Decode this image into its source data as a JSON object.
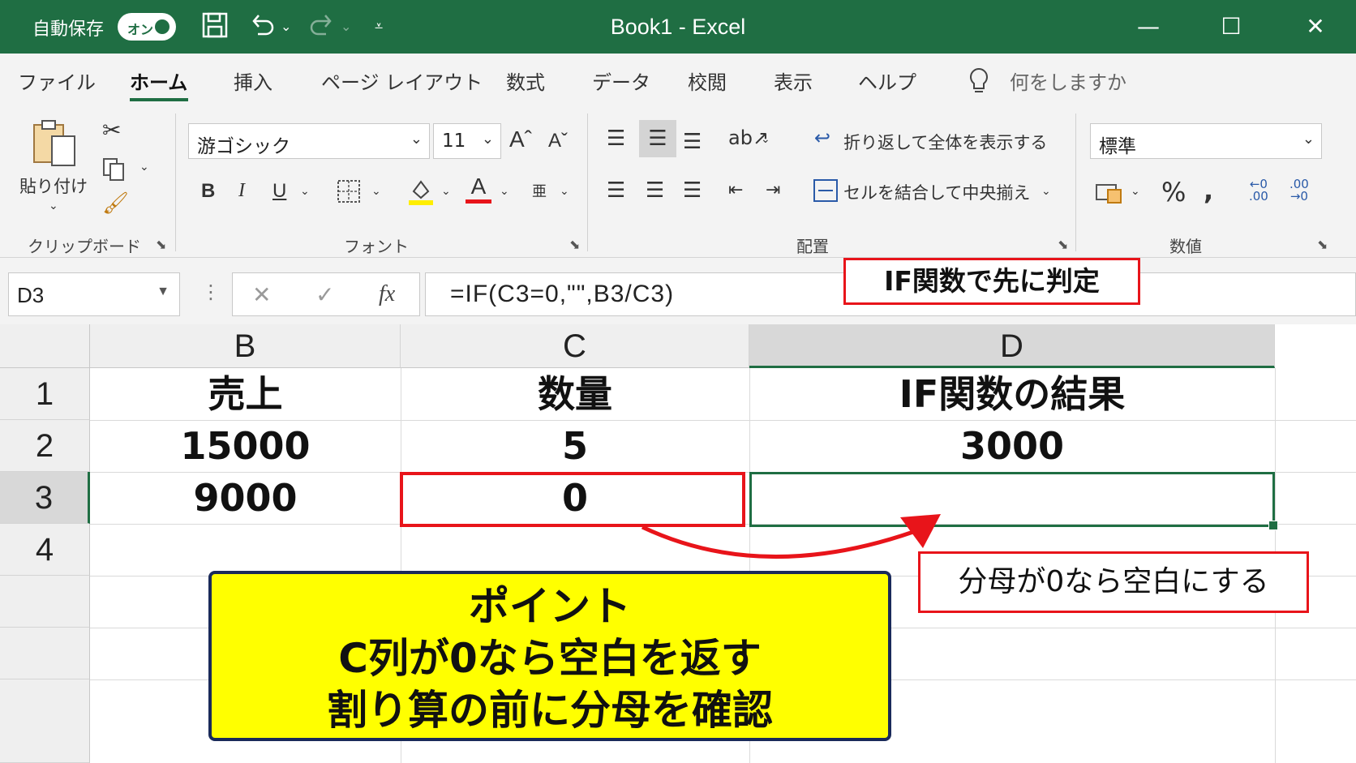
{
  "titlebar": {
    "autosave_label": "自動保存",
    "autosave_state": "オン",
    "title": "Book1  -  Excel"
  },
  "tabs": [
    "ファイル",
    "ホーム",
    "挿入",
    "ページ レイアウト",
    "数式",
    "データ",
    "校閲",
    "表示",
    "ヘルプ"
  ],
  "tell_me": "何をしますか",
  "ribbon": {
    "clipboard": {
      "paste_label": "貼り付け",
      "group_label": "クリップボード"
    },
    "font": {
      "font_name": "游ゴシック",
      "font_size": "11",
      "group_label": "フォント"
    },
    "alignment": {
      "wrap_text": "折り返して全体を表示する",
      "merge_center": "セルを結合して中央揃え",
      "group_label": "配置"
    },
    "number": {
      "format": "標準",
      "group_label": "数値"
    }
  },
  "formula_bar": {
    "name_box": "D3",
    "fx": "fx",
    "formula": "=IF(C3=0,\"\",B3/C3)"
  },
  "columns": [
    "B",
    "C",
    "D"
  ],
  "rows": [
    "1",
    "2",
    "3",
    "4"
  ],
  "cells": {
    "B1": "売上",
    "C1": "数量",
    "D1": "IF関数の結果",
    "B2": "15000",
    "C2": "5",
    "D2": "3000",
    "B3": "9000",
    "C3": "0",
    "D3": ""
  },
  "annotations": {
    "top_callout": "IF関数で先に判定",
    "side_callout": "分母が0なら空白にする",
    "point_title": "ポイント",
    "point_line1": "C列が0なら空白を返す",
    "point_line2": "割り算の前に分母を確認"
  },
  "colors": {
    "excel_green": "#1f6e43",
    "callout_red": "#e8141a",
    "highlight_yellow": "#ffff00"
  }
}
